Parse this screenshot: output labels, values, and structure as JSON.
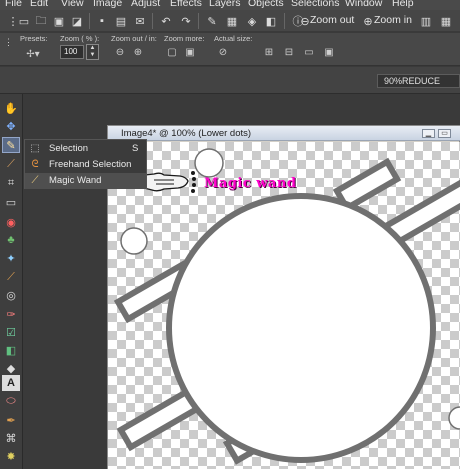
{
  "menu": [
    "File",
    "Edit",
    "View",
    "Image",
    "Adjust",
    "Effects",
    "Layers",
    "Objects",
    "Selections",
    "Window",
    "Help"
  ],
  "toolbar": {
    "zoom_out_label": "Zoom out",
    "zoom_in_label": "Zoom in"
  },
  "options": {
    "presets_label": "Presets:",
    "zoom_label": "Zoom ( % ):",
    "zoom_value": "100",
    "zoom_out_in_label": "Zoom out / in:",
    "zoom_more_label": "Zoom more:",
    "actual_size_label": "Actual size:"
  },
  "palette": {
    "preset_value": "90%REDUCE"
  },
  "flyout": {
    "items": [
      {
        "label": "Selection",
        "shortcut": "S",
        "icon": "selection-icon"
      },
      {
        "label": "Freehand Selection",
        "shortcut": "",
        "icon": "freehand-selection-icon"
      },
      {
        "label": "Magic Wand",
        "shortcut": "",
        "icon": "magic-wand-icon"
      }
    ]
  },
  "image_window": {
    "title": "Image4* @ 100% (Lower dots)"
  },
  "annotation": {
    "text": "Magic wand"
  },
  "colors": {
    "annotation": "#ff00cc",
    "active_tool": "#5a6b88"
  }
}
